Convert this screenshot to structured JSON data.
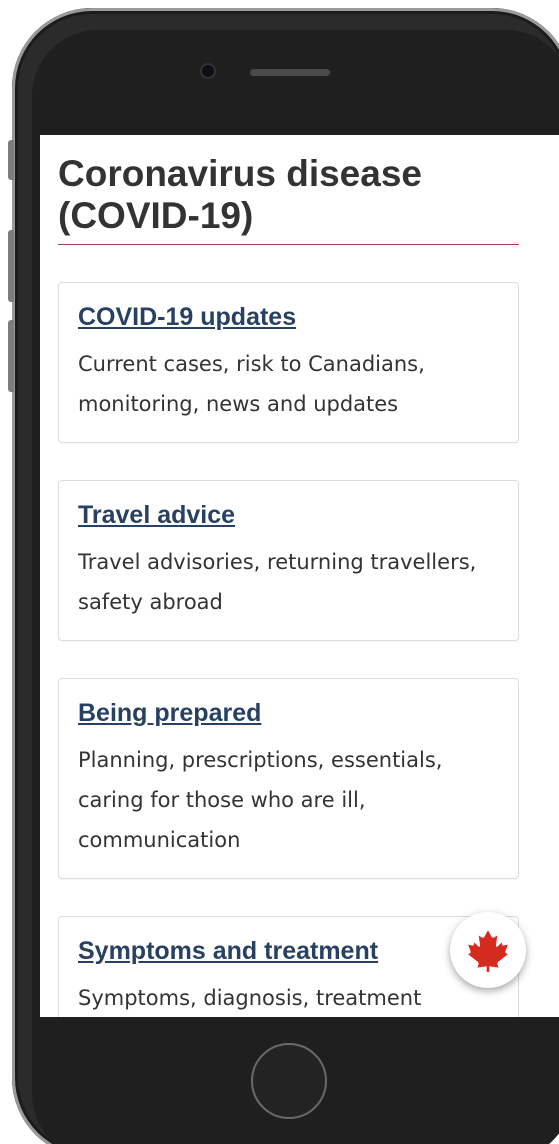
{
  "page": {
    "title": "Coronavirus disease (COVID-19)"
  },
  "cards": [
    {
      "link": "COVID-19 updates",
      "description": "Current cases, risk to Canadians, monitoring, news and updates"
    },
    {
      "link": "Travel advice",
      "description": "Travel advisories, returning travellers, safety abroad"
    },
    {
      "link": "Being prepared",
      "description": "Planning, prescriptions, essentials, caring for those who are ill, communication"
    },
    {
      "link": "Symptoms and treatment",
      "description": "Symptoms, diagnosis, treatment"
    }
  ],
  "floating_button": {
    "icon": "maple-leaf-icon",
    "color": "#d52b1e"
  },
  "colors": {
    "link": "#284162",
    "title_rule": "#af3c43",
    "text": "#333333"
  }
}
